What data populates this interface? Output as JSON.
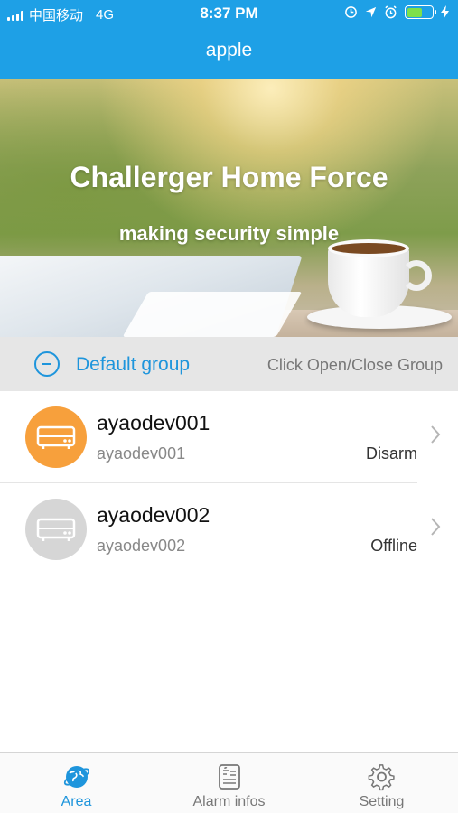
{
  "status_bar": {
    "carrier": "中国移动",
    "network": "4G",
    "time": "8:37 PM"
  },
  "header": {
    "title": "apple"
  },
  "banner": {
    "headline": "Challerger Home Force",
    "tagline": "making security simple"
  },
  "group": {
    "name": "Default group",
    "hint": "Click Open/Close Group"
  },
  "devices": [
    {
      "name": "ayaodev001",
      "id": "ayaodev001",
      "status": "Disarm",
      "color": "#f7a03c"
    },
    {
      "name": "ayaodev002",
      "id": "ayaodev002",
      "status": "Offline",
      "color": "#d6d6d6"
    }
  ],
  "tabs": [
    {
      "label": "Area",
      "icon": "globe-icon",
      "active": true
    },
    {
      "label": "Alarm infos",
      "icon": "alarm-list-icon",
      "active": false
    },
    {
      "label": "Setting",
      "icon": "gear-icon",
      "active": false
    }
  ],
  "colors": {
    "accent": "#1e95dc",
    "header_bg": "#1ea0e6"
  }
}
